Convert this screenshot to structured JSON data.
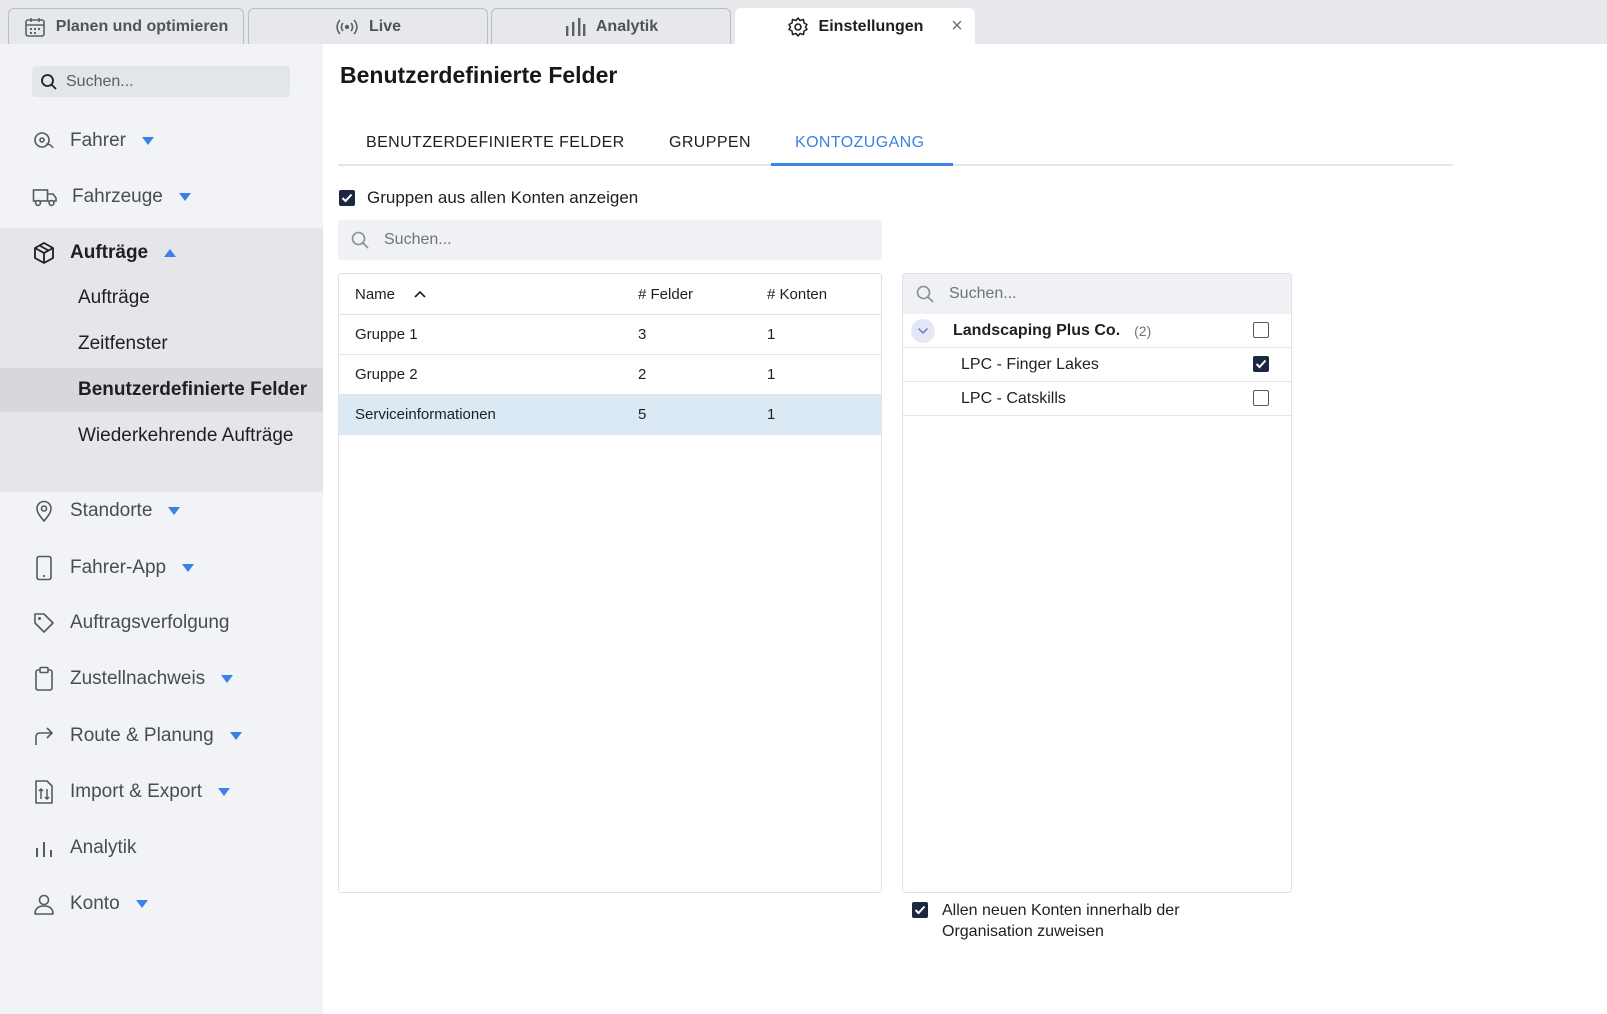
{
  "top_tabs": [
    {
      "label": "Planen und optimieren",
      "icon": "calendar-icon"
    },
    {
      "label": "Live",
      "icon": "broadcast-icon"
    },
    {
      "label": "Analytik",
      "icon": "bar-chart-icon"
    },
    {
      "label": "Einstellungen",
      "icon": "gear-icon",
      "active": true
    }
  ],
  "sidebar": {
    "search_placeholder": "Suchen...",
    "items": [
      {
        "label": "Fahrer",
        "icon": "driver-icon"
      },
      {
        "label": "Fahrzeuge",
        "icon": "truck-icon"
      },
      {
        "label": "Aufträge",
        "icon": "box-icon",
        "expanded": true
      },
      {
        "label": "Standorte",
        "icon": "location-pin-icon"
      },
      {
        "label": "Fahrer-App",
        "icon": "phone-icon"
      },
      {
        "label": "Auftragsverfolgung",
        "icon": "tag-icon"
      },
      {
        "label": "Zustellnachweis",
        "icon": "clipboard-icon"
      },
      {
        "label": "Route & Planung",
        "icon": "route-arrow-icon"
      },
      {
        "label": "Import & Export",
        "icon": "import-export-icon"
      },
      {
        "label": "Analytik",
        "icon": "bar-chart-icon"
      },
      {
        "label": "Konto",
        "icon": "user-icon"
      }
    ],
    "subitems": [
      {
        "label": "Aufträge"
      },
      {
        "label": "Zeitfenster"
      },
      {
        "label": "Benutzerdefinierte Felder",
        "selected": true
      },
      {
        "label": "Wiederkehrende Aufträge"
      }
    ]
  },
  "main": {
    "title": "Benutzerdefinierte Felder",
    "tabs": [
      {
        "label": "BENUTZERDEFINIERTE FELDER"
      },
      {
        "label": "GRUPPEN"
      },
      {
        "label": "KONTOZUGANG",
        "active": true
      }
    ],
    "show_all_label": "Gruppen aus allen Konten anzeigen",
    "show_all_checked": true,
    "group_search_placeholder": "Suchen...",
    "group_table": {
      "headers": {
        "name": "Name",
        "fields": "# Felder",
        "accounts": "# Konten"
      },
      "rows": [
        {
          "name": "Gruppe 1",
          "fields": "3",
          "accounts": "1"
        },
        {
          "name": "Gruppe 2",
          "fields": "2",
          "accounts": "1"
        },
        {
          "name": "Serviceinformationen",
          "fields": "5",
          "accounts": "1",
          "selected": true
        }
      ]
    },
    "account_panel": {
      "search_placeholder": "Suchen...",
      "org": {
        "name": "Landscaping Plus Co.",
        "count": "(2)",
        "checked": false
      },
      "accounts": [
        {
          "name": "LPC - Finger Lakes",
          "checked": true
        },
        {
          "name": "LPC - Catskills",
          "checked": false
        }
      ]
    },
    "assign_new_label": "Allen neuen Konten innerhalb der Organisation zuweisen",
    "assign_new_checked": true
  },
  "colors": {
    "accent": "#3b82e4",
    "selected_row": "#dbe9f5",
    "checkbox_on": "#1b2840"
  }
}
